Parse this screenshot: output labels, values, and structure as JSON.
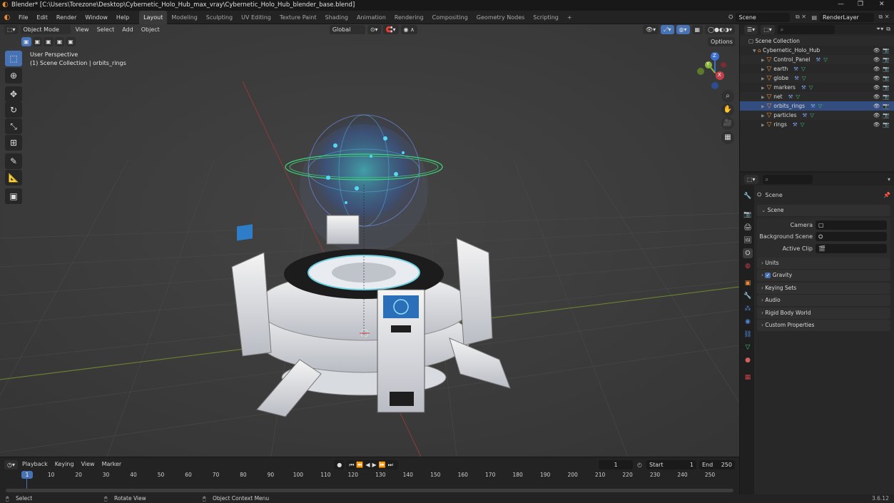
{
  "titlebar": {
    "title": "Blender* [C:\\Users\\Torezone\\Desktop\\Cybernetic_Holo_Hub_max_vray\\Cybernetic_Holo_Hub_blender_base.blend]",
    "minimize": "—",
    "restore": "❐",
    "close": "✕"
  },
  "menu": {
    "items": [
      "File",
      "Edit",
      "Render",
      "Window",
      "Help"
    ]
  },
  "workspaces": [
    "Layout",
    "Modeling",
    "Sculpting",
    "UV Editing",
    "Texture Paint",
    "Shading",
    "Animation",
    "Rendering",
    "Compositing",
    "Geometry Nodes",
    "Scripting"
  ],
  "workspace_add": "+",
  "scene": {
    "name": "Scene",
    "render_layer": "RenderLayer"
  },
  "viewport": {
    "mode": "Object Mode",
    "menu": [
      "View",
      "Select",
      "Add",
      "Object"
    ],
    "transform_orientation": "Global",
    "options": "Options",
    "info_line1": "User Perspective",
    "info_line2": "(1) Scene Collection | orbits_rings",
    "gizmo": {
      "z": "Z",
      "y": "Y",
      "x": "X"
    }
  },
  "tools": [
    {
      "name": "select-box-tool",
      "glyph": "⬚"
    },
    {
      "name": "cursor-tool",
      "glyph": "⊕"
    },
    {
      "name": "move-tool",
      "glyph": "✥"
    },
    {
      "name": "rotate-tool",
      "glyph": "↻"
    },
    {
      "name": "scale-tool",
      "glyph": "⤡"
    },
    {
      "name": "transform-tool",
      "glyph": "⊞"
    },
    {
      "name": "annotate-tool",
      "glyph": "✎"
    },
    {
      "name": "measure-tool",
      "glyph": "📐"
    },
    {
      "name": "add-cube-tool",
      "glyph": "▣"
    }
  ],
  "outliner": {
    "root": "Scene Collection",
    "collection": "Cybernetic_Holo_Hub",
    "objects": [
      "Control_Panel",
      "earth",
      "globe",
      "markers",
      "net",
      "orbits_rings",
      "particles",
      "rings"
    ],
    "selected": "orbits_rings"
  },
  "properties": {
    "header": "Scene",
    "section": "Scene",
    "fields": [
      {
        "label": "Camera"
      },
      {
        "label": "Background Scene"
      },
      {
        "label": "Active Clip"
      }
    ],
    "panels": [
      "Units",
      "Gravity",
      "Keying Sets",
      "Audio",
      "Rigid Body World",
      "Custom Properties"
    ],
    "gravity_checked": true
  },
  "timeline": {
    "menu": [
      "Playback",
      "Keying",
      "View",
      "Marker"
    ],
    "current_frame": "1",
    "start_label": "Start",
    "start": "1",
    "end_label": "End",
    "end": "250",
    "ticks": [
      "10",
      "20",
      "30",
      "40",
      "50",
      "60",
      "70",
      "80",
      "90",
      "100",
      "110",
      "120",
      "130",
      "140",
      "150",
      "160",
      "170",
      "180",
      "190",
      "200",
      "210",
      "220",
      "230",
      "240",
      "250"
    ],
    "playhead": "1"
  },
  "status": {
    "select": "Select",
    "rotate": "Rotate View",
    "context": "Object Context Menu",
    "version": "3.6.12"
  },
  "colors": {
    "accent": "#4772b3",
    "object": "#e88b3b",
    "axis_x": "#c2404b",
    "axis_y": "#8ab538",
    "axis_z": "#3c6fd0"
  }
}
